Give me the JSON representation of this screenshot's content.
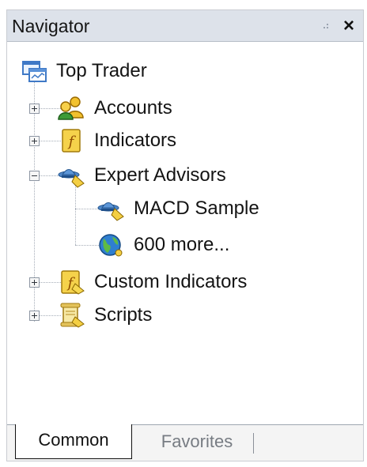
{
  "window": {
    "title": "Navigator",
    "close_label": "×"
  },
  "tree": {
    "root": {
      "label": "Top Trader",
      "icon": "terminal-icon"
    },
    "items": [
      {
        "label": "Accounts",
        "icon": "accounts-icon",
        "expanded": false
      },
      {
        "label": "Indicators",
        "icon": "indicator-icon",
        "expanded": false
      },
      {
        "label": "Expert Advisors",
        "icon": "expert-advisor-icon",
        "expanded": true,
        "children": [
          {
            "label": "MACD Sample",
            "icon": "expert-advisor-icon"
          },
          {
            "label": "600 more...",
            "icon": "globe-icon"
          }
        ]
      },
      {
        "label": "Custom Indicators",
        "icon": "custom-indicator-icon",
        "expanded": false
      },
      {
        "label": "Scripts",
        "icon": "script-icon",
        "expanded": false
      }
    ]
  },
  "tabs": [
    {
      "label": "Common",
      "active": true
    },
    {
      "label": "Favorites",
      "active": false
    }
  ],
  "colors": {
    "title_bar": "#dde2ea",
    "tree_lines": "#a6adb8",
    "inactive_tab_text": "#777c83"
  }
}
